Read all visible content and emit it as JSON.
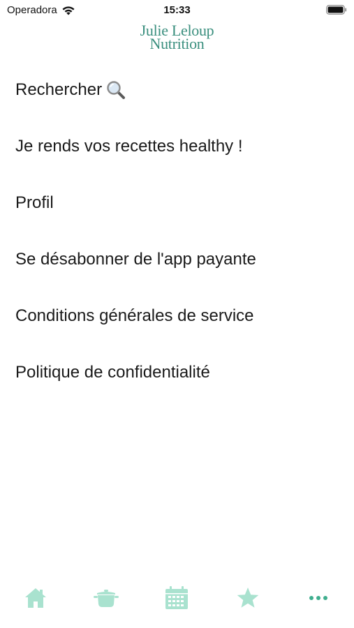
{
  "status_bar": {
    "carrier": "Operadora",
    "time": "15:33",
    "wifi_icon": "wifi-icon",
    "battery_icon": "battery-icon"
  },
  "logo": {
    "line1": "Julie Leloup",
    "line2": "Nutrition"
  },
  "menu": {
    "items": [
      {
        "label": "Rechercher",
        "icon": "search-icon"
      },
      {
        "label": "Je rends vos recettes healthy !"
      },
      {
        "label": "Profil"
      },
      {
        "label": "Se désabonner de l'app payante"
      },
      {
        "label": "Conditions générales de service"
      },
      {
        "label": "Politique de confidentialité"
      }
    ]
  },
  "tab_bar": {
    "accent_color": "#a9e2cf",
    "more_color": "#3fae8e",
    "tabs": [
      {
        "icon": "home-icon"
      },
      {
        "icon": "cooking-pot-icon"
      },
      {
        "icon": "calendar-icon"
      },
      {
        "icon": "star-icon"
      },
      {
        "icon": "more-dots-icon"
      }
    ]
  }
}
